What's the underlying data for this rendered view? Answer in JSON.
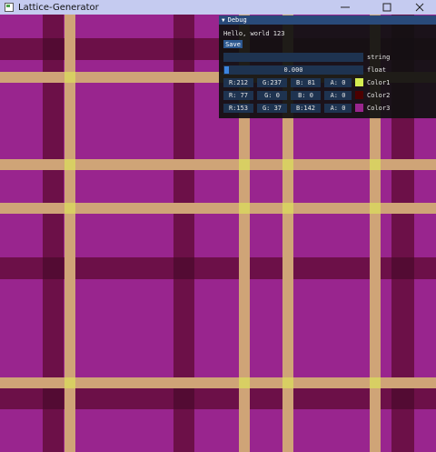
{
  "window": {
    "title": "Lattice-Generator",
    "controls": [
      "minimize",
      "maximize",
      "close"
    ]
  },
  "debug": {
    "title": "Debug",
    "text": "Hello, world 123",
    "save_label": "Save",
    "string_label": "string",
    "string_value": "",
    "float_label": "float",
    "float_value": "0.000",
    "colors": [
      {
        "label": "Color1",
        "r": "R:212",
        "g": "G:237",
        "b": "B: 81",
        "a": "A:  0",
        "hex": "#d4ed51"
      },
      {
        "label": "Color2",
        "r": "R: 77",
        "g": "G:  0",
        "b": "B:  0",
        "a": "A:  0",
        "hex": "#4d0000"
      },
      {
        "label": "Color3",
        "r": "R:153",
        "g": "G: 37",
        "b": "B:142",
        "a": "A:  0",
        "hex": "#99258e"
      }
    ]
  },
  "lattice": {
    "background": "#99258e",
    "light_line": "#cfa477",
    "dark_band": "#6c1048"
  }
}
